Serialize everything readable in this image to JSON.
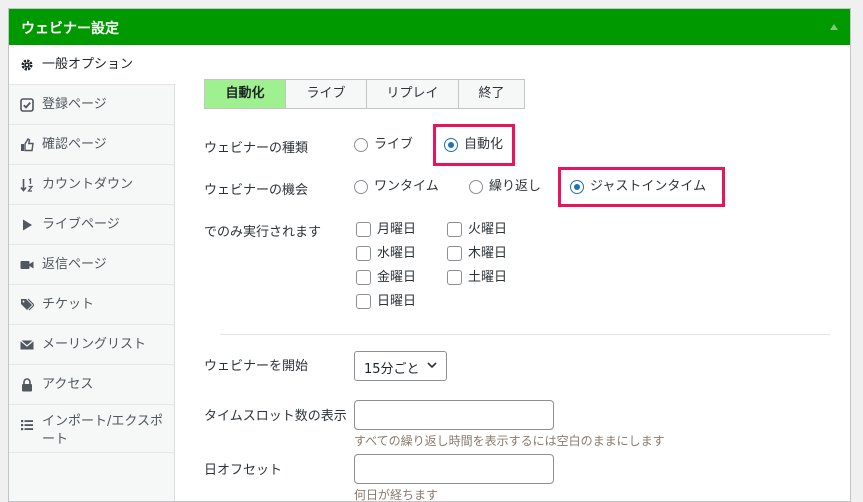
{
  "panel": {
    "title": "ウェビナー設定"
  },
  "sidebar": {
    "items": [
      {
        "label": "一般オプション",
        "icon": "gear-icon",
        "active": true
      },
      {
        "label": "登録ページ",
        "icon": "check-square-icon"
      },
      {
        "label": "確認ページ",
        "icon": "thumbs-up-icon"
      },
      {
        "label": "カウントダウン",
        "icon": "sort-icon"
      },
      {
        "label": "ライブページ",
        "icon": "play-icon"
      },
      {
        "label": "返信ページ",
        "icon": "video-camera-icon"
      },
      {
        "label": "チケット",
        "icon": "tags-icon"
      },
      {
        "label": "メーリングリスト",
        "icon": "envelope-icon"
      },
      {
        "label": "アクセス",
        "icon": "lock-icon"
      },
      {
        "label": "インポート/エクスポート",
        "icon": "list-icon"
      }
    ]
  },
  "tabs": [
    {
      "label": "自動化",
      "active": true
    },
    {
      "label": "ライブ"
    },
    {
      "label": "リプレイ"
    },
    {
      "label": "終了"
    }
  ],
  "form": {
    "webinar_type": {
      "label": "ウェビナーの種類",
      "options": [
        {
          "label": "ライブ",
          "checked": false
        },
        {
          "label": "自動化",
          "checked": true
        }
      ]
    },
    "webinar_occasion": {
      "label": "ウェビナーの機会",
      "options": [
        {
          "label": "ワンタイム",
          "checked": false
        },
        {
          "label": "繰り返し",
          "checked": false
        },
        {
          "label": "ジャストインタイム",
          "checked": true
        }
      ]
    },
    "run_days": {
      "label": "でのみ実行されます",
      "days": [
        "月曜日",
        "火曜日",
        "水曜日",
        "木曜日",
        "金曜日",
        "土曜日",
        "日曜日"
      ]
    },
    "start": {
      "label": "ウェビナーを開始",
      "value": "15分ごと"
    },
    "time_slots": {
      "label": "タイムスロット数の表示",
      "value": "",
      "help": "すべての繰り返し時間を表示するには空白のままにします"
    },
    "day_offset": {
      "label": "日オフセット",
      "value": "",
      "help": "何日が経ちます"
    }
  },
  "colors": {
    "header_bg": "#009900",
    "active_tab_bg": "#9ff08f",
    "highlight": "#e8145c",
    "radio_accent": "#2271b1"
  }
}
